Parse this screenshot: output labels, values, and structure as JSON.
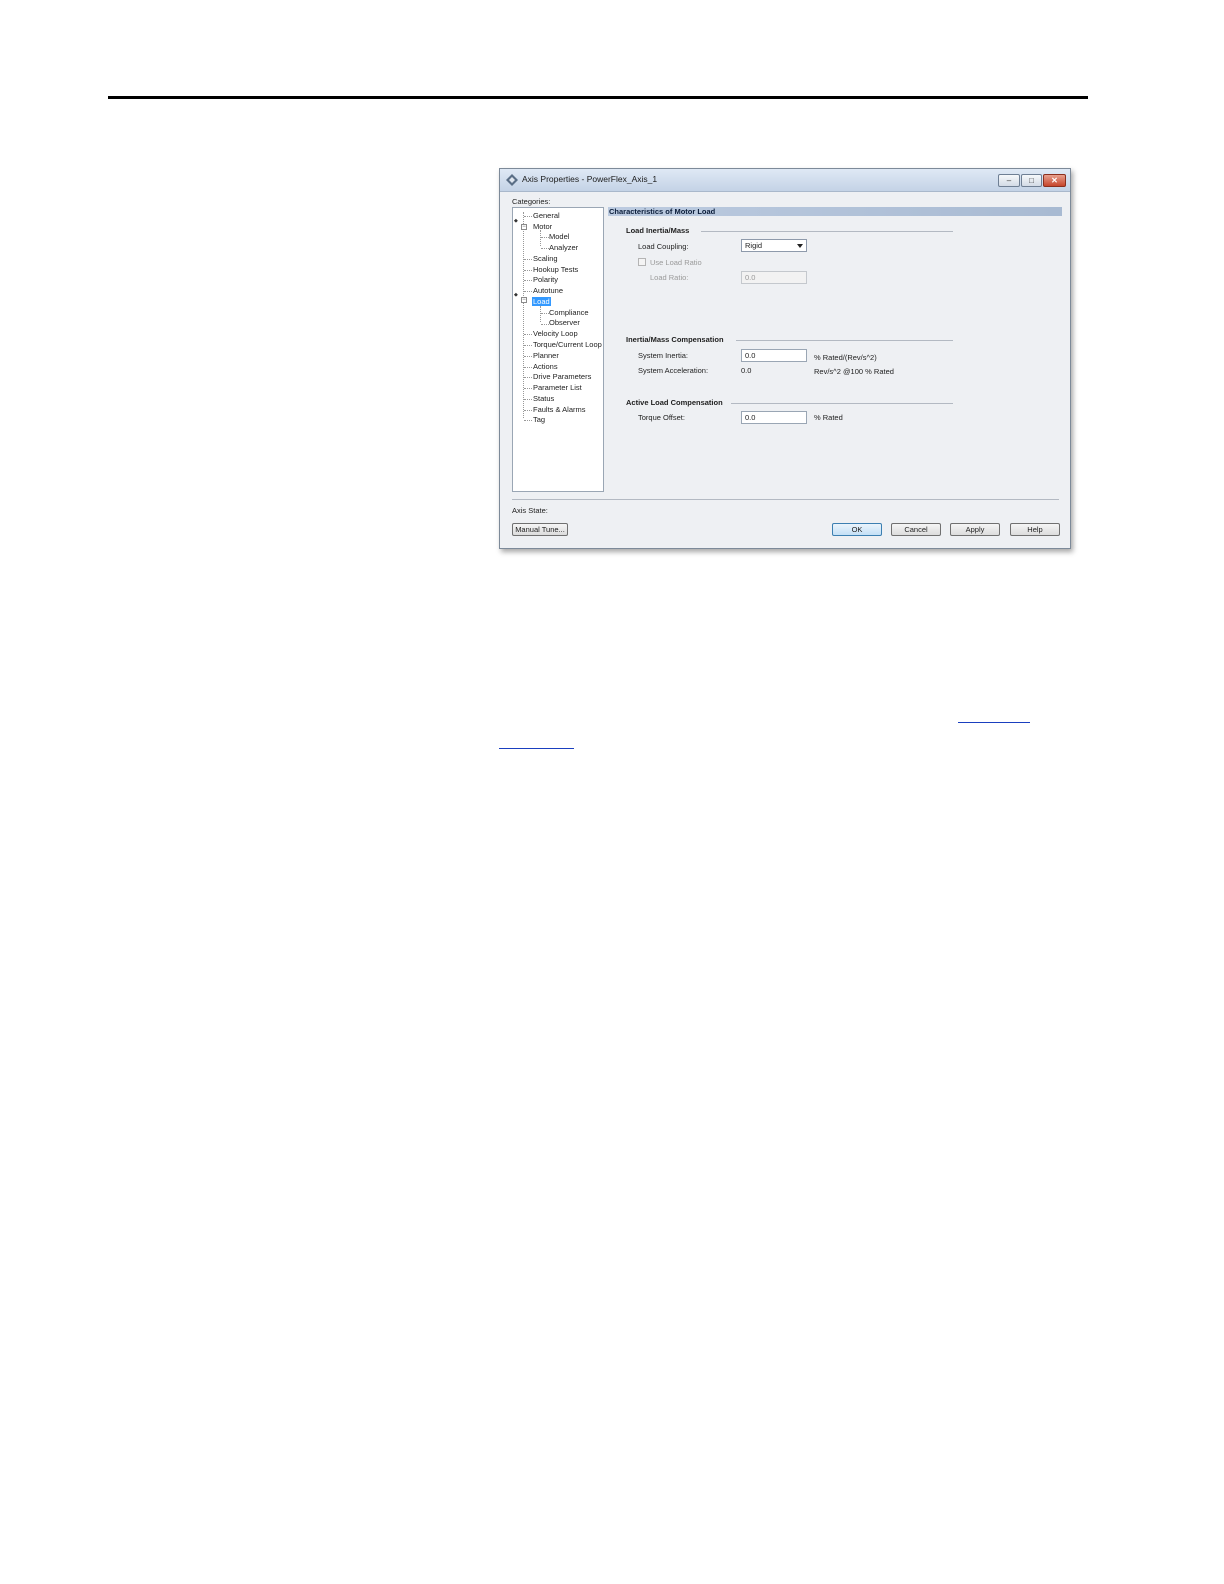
{
  "window": {
    "title": "Axis Properties - PowerFlex_Axis_1",
    "controls": {
      "minimize": "–",
      "maximize": "□",
      "close": "✕"
    }
  },
  "categories": {
    "label": "Categories:",
    "items": [
      {
        "label": "General",
        "level": 0
      },
      {
        "label": "Motor",
        "level": 0,
        "expanded": true
      },
      {
        "label": "Model",
        "level": 1
      },
      {
        "label": "Analyzer",
        "level": 1
      },
      {
        "label": "Scaling",
        "level": 0
      },
      {
        "label": "Hookup Tests",
        "level": 0
      },
      {
        "label": "Polarity",
        "level": 0
      },
      {
        "label": "Autotune",
        "level": 0
      },
      {
        "label": "Load",
        "level": 0,
        "expanded": true,
        "selected": true
      },
      {
        "label": "Compliance",
        "level": 1
      },
      {
        "label": "Observer",
        "level": 1
      },
      {
        "label": "Velocity Loop",
        "level": 0
      },
      {
        "label": "Torque/Current Loop",
        "level": 0
      },
      {
        "label": "Planner",
        "level": 0
      },
      {
        "label": "Actions",
        "level": 0
      },
      {
        "label": "Drive Parameters",
        "level": 0
      },
      {
        "label": "Parameter List",
        "level": 0
      },
      {
        "label": "Status",
        "level": 0
      },
      {
        "label": "Faults & Alarms",
        "level": 0
      },
      {
        "label": "Tag",
        "level": 0
      }
    ]
  },
  "main": {
    "header": "Characteristics of Motor Load",
    "load_inertia": {
      "title": "Load Inertia/Mass",
      "load_coupling_label": "Load Coupling:",
      "load_coupling_value": "Rigid",
      "use_load_ratio_label": "Use Load Ratio",
      "use_load_ratio_checked": false,
      "load_ratio_label": "Load Ratio:",
      "load_ratio_value": "0.0"
    },
    "compensation": {
      "title": "Inertia/Mass Compensation",
      "system_inertia_label": "System Inertia:",
      "system_inertia_value": "0.0",
      "system_inertia_unit": "% Rated/(Rev/s^2)",
      "system_accel_label": "System Acceleration:",
      "system_accel_value": "0.0",
      "system_accel_unit": "Rev/s^2 @100 % Rated"
    },
    "active_load": {
      "title": "Active Load Compensation",
      "torque_offset_label": "Torque Offset:",
      "torque_offset_value": "0.0",
      "torque_offset_unit": "% Rated"
    }
  },
  "footer": {
    "axis_state_label": "Axis State:",
    "manual_tune": "Manual Tune...",
    "ok": "OK",
    "cancel": "Cancel",
    "apply": "Apply",
    "help": "Help"
  },
  "colors": {
    "selection": "#3399ff",
    "section_header": "#b4c4db",
    "link": "#1a3fbf"
  }
}
